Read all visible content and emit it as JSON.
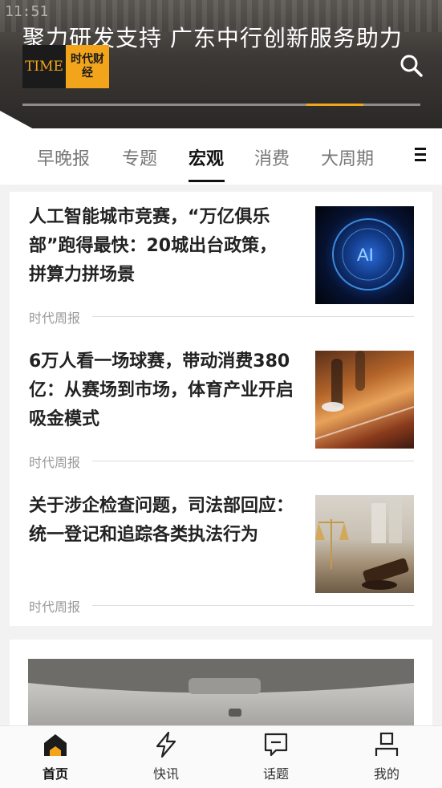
{
  "status": {
    "time": "11:51"
  },
  "banner": {
    "headline": "聚力研发支持 广东中行创新服务助力科创",
    "logo_en": "TIME",
    "logo_cn": "时代财经",
    "search_icon": "search-icon",
    "accent_color": "#f2a51b"
  },
  "tabs": {
    "items": [
      {
        "label": "早晚报",
        "active": false
      },
      {
        "label": "专题",
        "active": false
      },
      {
        "label": "宏观",
        "active": true
      },
      {
        "label": "消费",
        "active": false
      },
      {
        "label": "大周期",
        "active": false
      }
    ],
    "menu_icon": "menu-icon"
  },
  "articles": [
    {
      "title": "人工智能城市竞赛，“万亿俱乐部”跑得最快：20城出台政策，拼算力拼场景",
      "source": "时代周报",
      "thumbnail_text": "AI"
    },
    {
      "title": "6万人看一场球赛，带动消费380亿：从赛场到市场，体育产业开启吸金模式",
      "source": "时代周报"
    },
    {
      "title": "关于涉企检查问题，司法部回应：统一登记和追踪各类执法行为",
      "source": "时代周报"
    }
  ],
  "bottom_nav": {
    "items": [
      {
        "label": "首页",
        "icon": "home-icon",
        "active": true
      },
      {
        "label": "快讯",
        "icon": "lightning-icon",
        "active": false
      },
      {
        "label": "话题",
        "icon": "comment-icon",
        "active": false
      },
      {
        "label": "我的",
        "icon": "profile-icon",
        "active": false
      }
    ]
  }
}
